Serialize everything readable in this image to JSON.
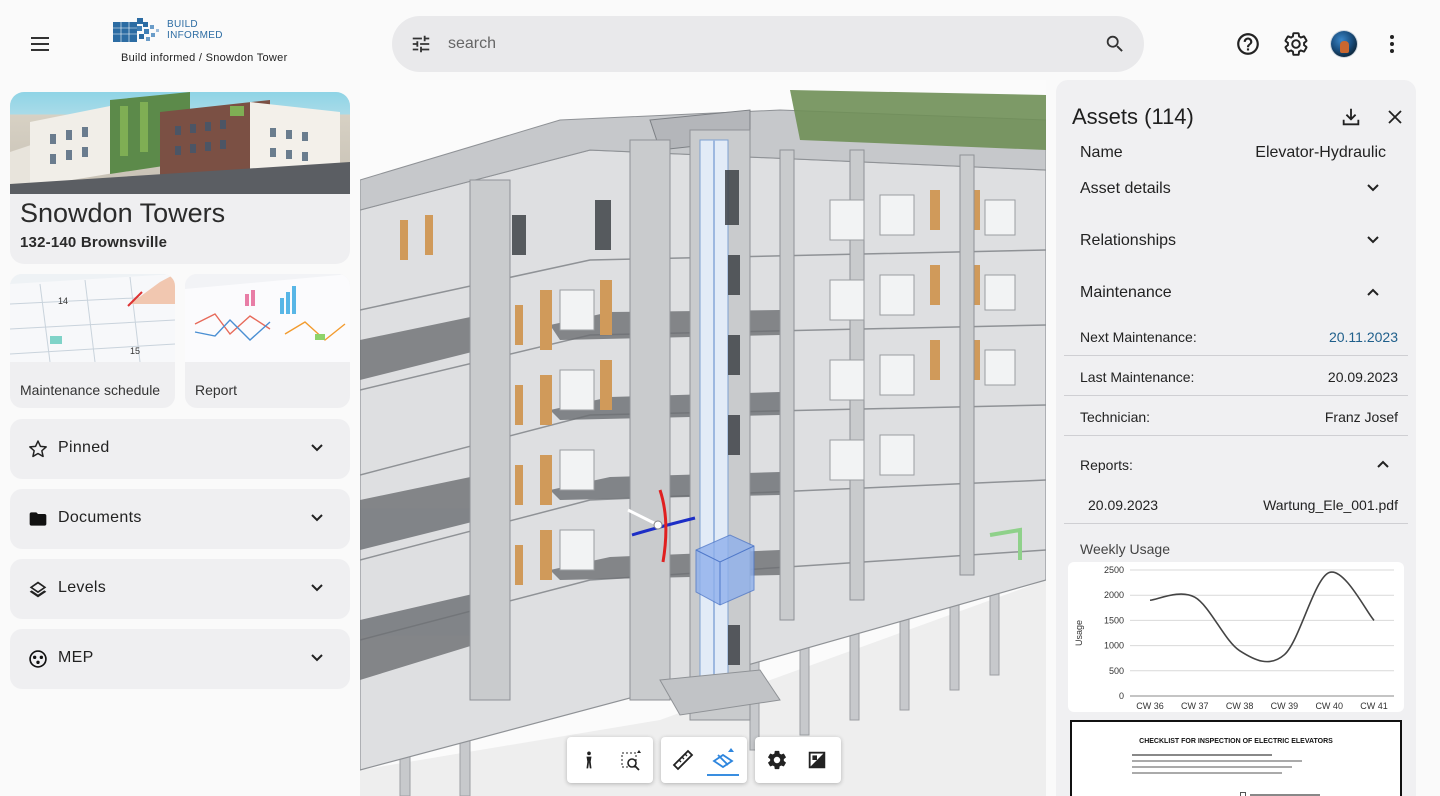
{
  "header": {
    "brand_name": "BUILD INFORMED",
    "breadcrumb": "Build informed / Snowdon Tower",
    "search_placeholder": "search"
  },
  "project": {
    "title": "Snowdon Towers",
    "address": "132-140 Brownsville"
  },
  "tiles": [
    {
      "label": "Maintenance schedule"
    },
    {
      "label": "Report"
    }
  ],
  "accordions": [
    {
      "label": "Pinned",
      "icon": "star-icon"
    },
    {
      "label": "Documents",
      "icon": "folder-icon"
    },
    {
      "label": "Levels",
      "icon": "layers-icon"
    },
    {
      "label": "MEP",
      "icon": "mep-icon"
    }
  ],
  "assets": {
    "title": "Assets (114)",
    "name_label": "Name",
    "name_value": "Elevator-Hydraulic",
    "sections": {
      "asset_details": "Asset details",
      "relationships": "Relationships",
      "maintenance": "Maintenance"
    },
    "maintenance": {
      "next_label": "Next Maintenance:",
      "next_value": "20.11.2023",
      "last_label": "Last Maintenance:",
      "last_value": "20.09.2023",
      "tech_label": "Technician:",
      "tech_value": "Franz Josef",
      "reports_label": "Reports:",
      "report_date": "20.09.2023",
      "report_file": "Wartung_Ele_001.pdf"
    },
    "chart_title": "Weekly Usage",
    "document_title": "CHECKLIST FOR INSPECTION OF ELECTRIC ELEVATORS"
  },
  "chart_data": {
    "type": "line",
    "title": "Weekly Usage",
    "xlabel": "",
    "ylabel": "Usage",
    "categories": [
      "CW 36",
      "CW 37",
      "CW 38",
      "CW 39",
      "CW 40",
      "CW 41"
    ],
    "series": [
      {
        "values": [
          1900,
          1960,
          900,
          820,
          2450,
          1500
        ]
      }
    ],
    "ylim": [
      0,
      2500
    ],
    "yticks": [
      0,
      500,
      1000,
      1500,
      2000,
      2500
    ],
    "grid": true,
    "line_color": "#444444"
  },
  "colors": {
    "link": "#1f5f8b",
    "panel_bg": "#f0f0f2",
    "search_bg": "#e9e9eb"
  }
}
